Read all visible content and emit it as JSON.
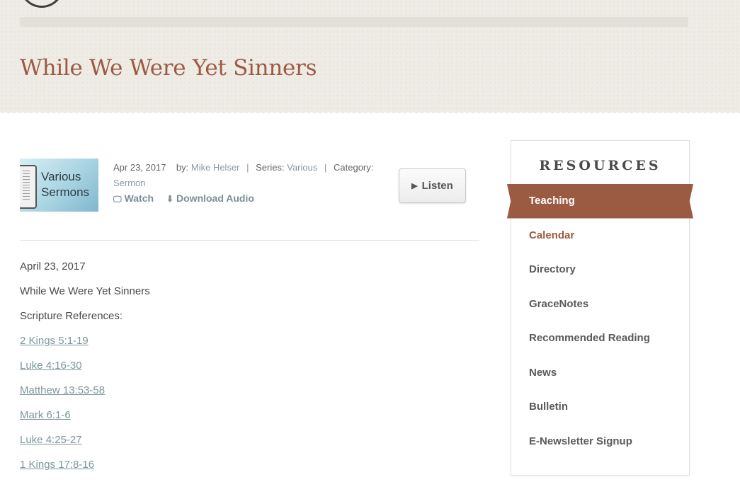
{
  "page": {
    "title": "While We Were Yet Sinners"
  },
  "sermon": {
    "thumbnail_text_line1": "Various",
    "thumbnail_text_line2": "Sermons",
    "date": "Apr 23, 2017",
    "by_label": "by:",
    "speaker": "Mike Helser",
    "series_label": "Series:",
    "series": "Various",
    "category_label": "Category:",
    "category": "Sermon",
    "watch_label": "Watch",
    "download_label": "Download Audio",
    "listen_label": "Listen",
    "separator": "|"
  },
  "content": {
    "date_line": "April 23, 2017",
    "title_line": "While We Were Yet Sinners",
    "scripture_heading": "Scripture References:",
    "references": [
      "2 Kings 5:1-19",
      "Luke 4:16-30",
      "Matthew 13:53-58",
      "Mark 6:1-6",
      "Luke 4:25-27",
      "1 Kings 17:8-16"
    ]
  },
  "sidebar": {
    "heading": "RESOURCES",
    "items": [
      {
        "label": "Teaching"
      },
      {
        "label": "Calendar"
      },
      {
        "label": "Directory"
      },
      {
        "label": "GraceNotes"
      },
      {
        "label": "Recommended Reading"
      },
      {
        "label": "News"
      },
      {
        "label": "Bulletin"
      },
      {
        "label": "E-Newsletter Signup"
      }
    ],
    "active_item": "Teaching"
  },
  "colors": {
    "accent": "#9b5a42",
    "link": "#7d979c",
    "header_bg": "#efece6"
  },
  "icons": {
    "watch": "monitor-icon",
    "download": "download-arrow-icon",
    "listen": "play-icon"
  }
}
